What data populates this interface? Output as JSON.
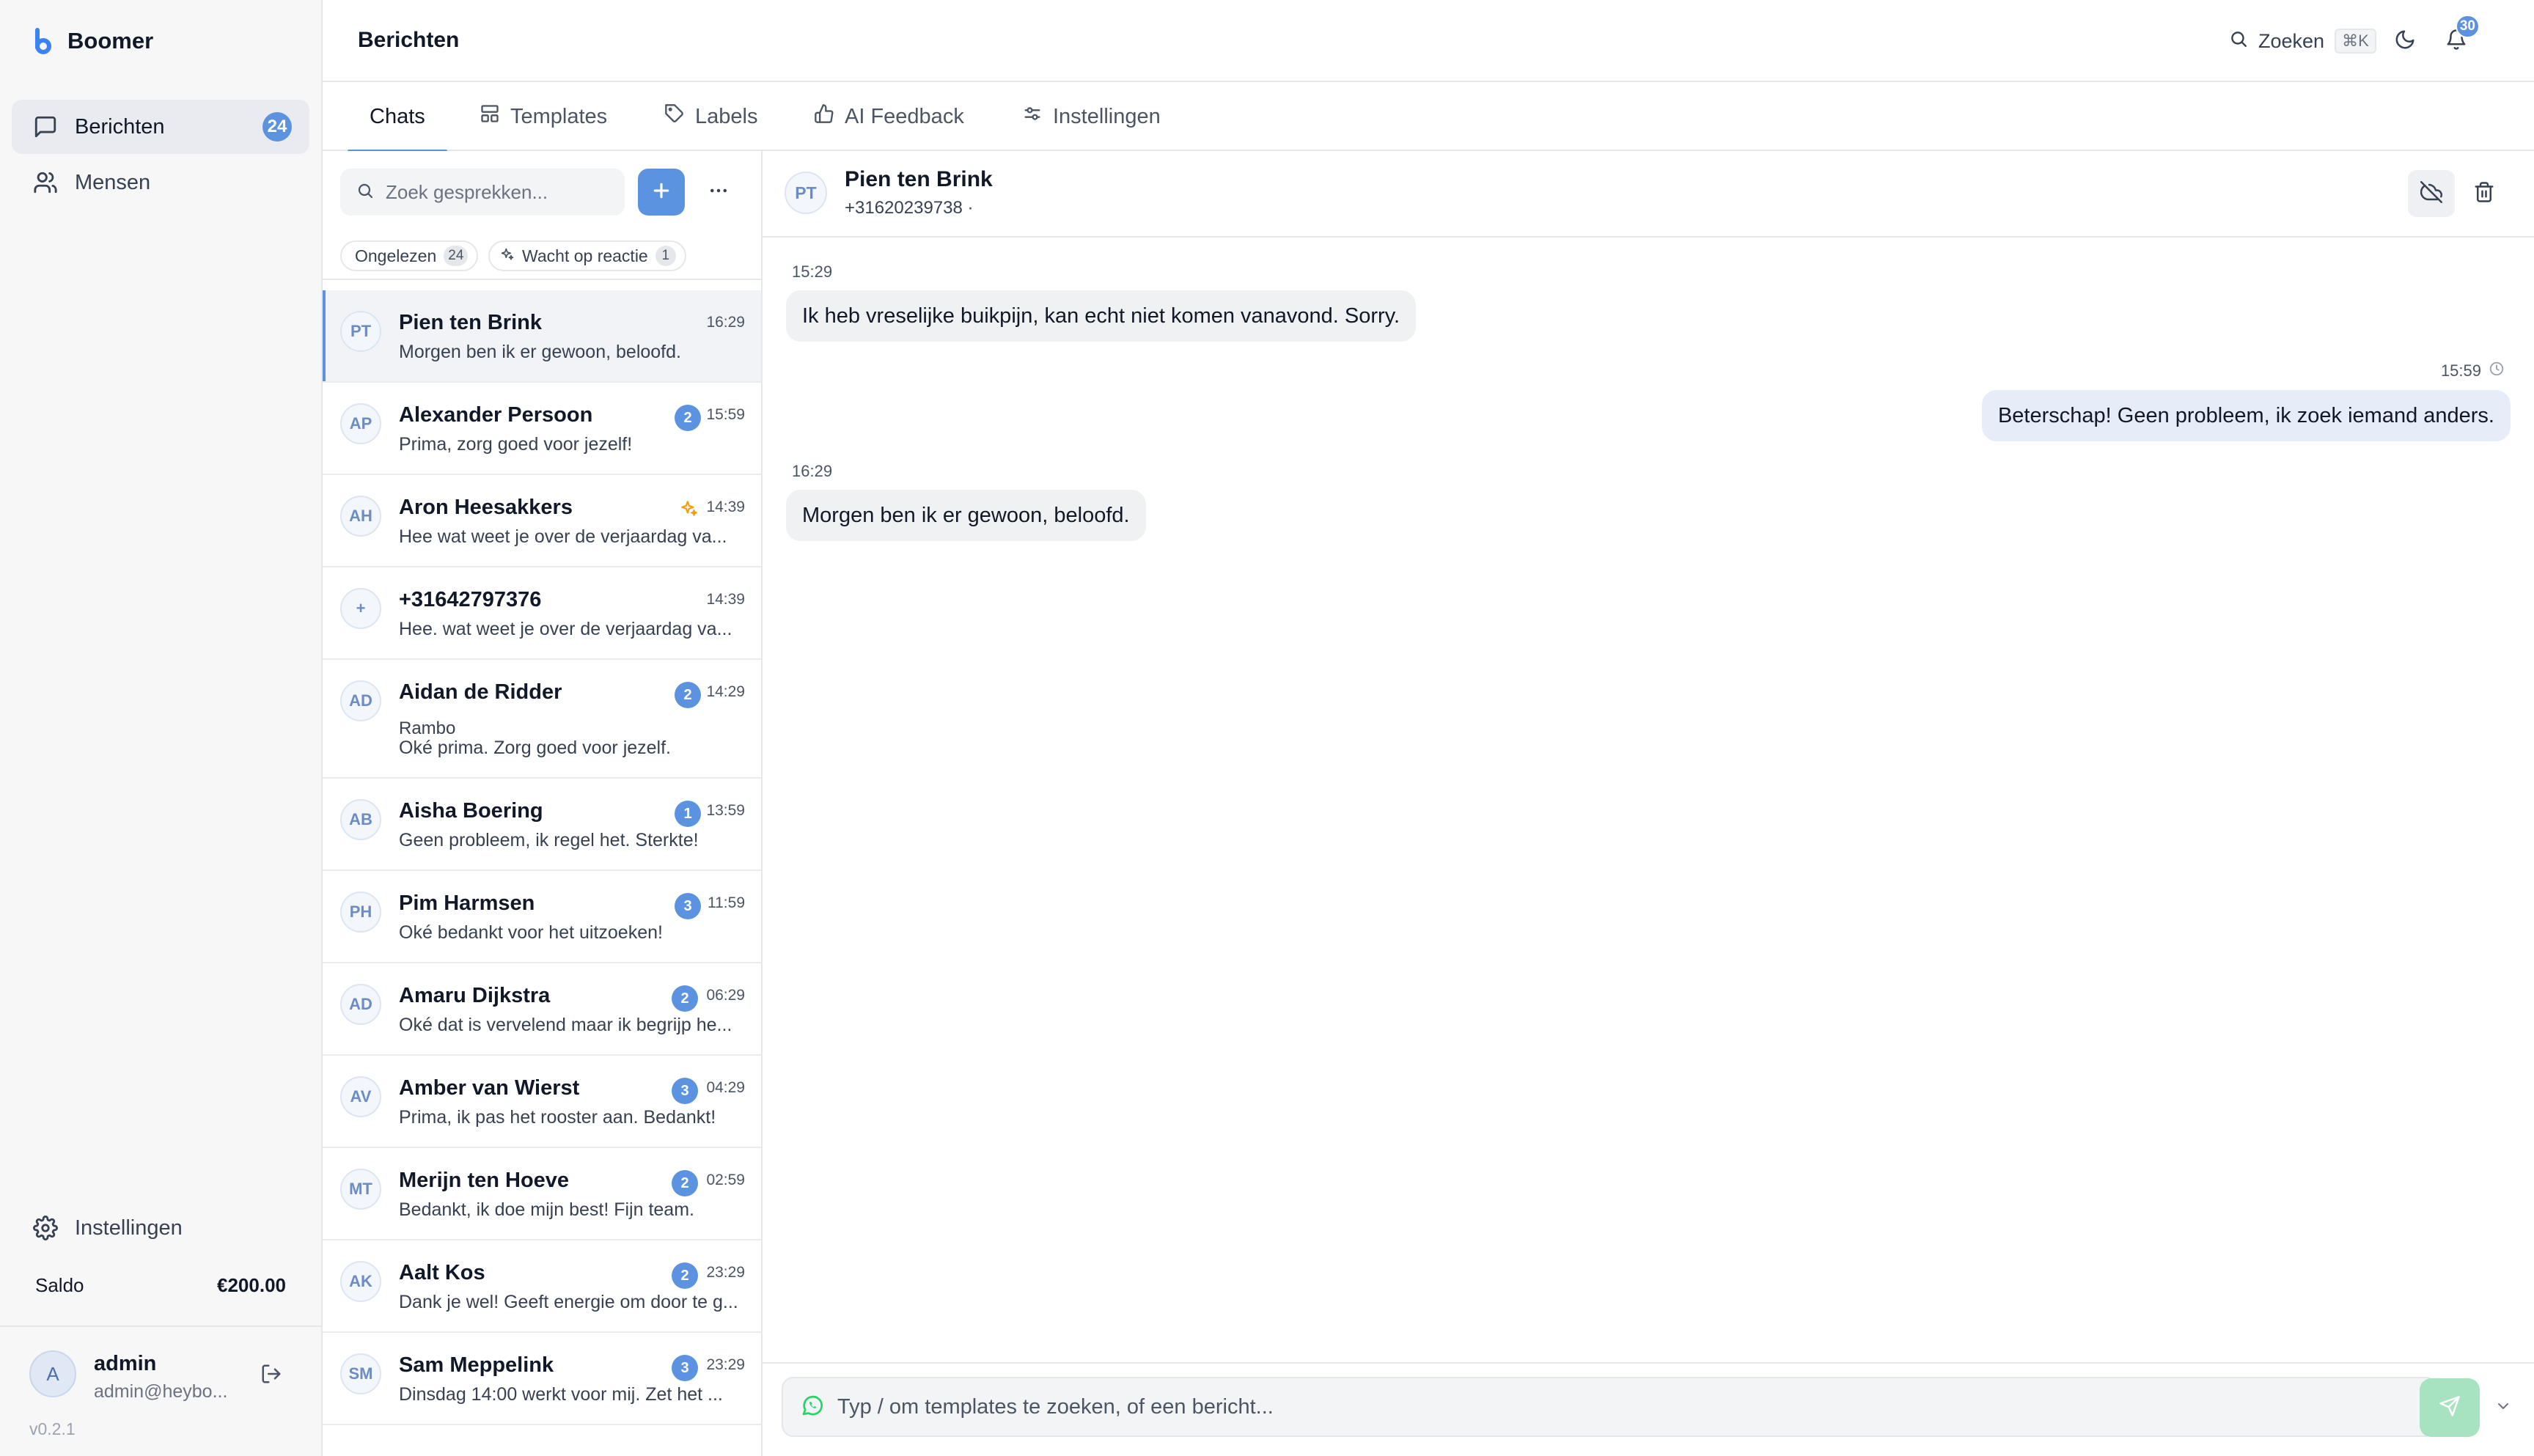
{
  "brand": {
    "name": "Boomer"
  },
  "sidebar": {
    "items": [
      {
        "label": "Berichten",
        "icon": "message-square-icon",
        "badge": "24",
        "active": true
      },
      {
        "label": "Mensen",
        "icon": "users-icon"
      }
    ],
    "settings_label": "Instellingen",
    "balance_label": "Saldo",
    "balance_value": "€200.00",
    "user": {
      "initial": "A",
      "name": "admin",
      "email": "admin@heybo..."
    },
    "version": "v0.2.1"
  },
  "header": {
    "title": "Berichten",
    "search_label": "Zoeken",
    "search_shortcut": "⌘K",
    "notifications_count": "30"
  },
  "tabs": [
    {
      "label": "Chats",
      "icon": "",
      "active": true
    },
    {
      "label": "Templates",
      "icon": "layout-icon"
    },
    {
      "label": "Labels",
      "icon": "tag-icon"
    },
    {
      "label": "AI Feedback",
      "icon": "thumbs-up-icon"
    },
    {
      "label": "Instellingen",
      "icon": "sliders-icon"
    }
  ],
  "chatlist": {
    "search_placeholder": "Zoek gesprekken...",
    "filters": [
      {
        "label": "Ongelezen",
        "count": "24"
      },
      {
        "label": "Wacht op reactie",
        "count": "1"
      }
    ],
    "rows": [
      {
        "initials": "PT",
        "name": "Pien ten Brink",
        "time": "16:29",
        "preview": "Morgen ben ik er gewoon, beloofd.",
        "selected": true
      },
      {
        "initials": "AP",
        "name": "Alexander Persoon",
        "time": "15:59",
        "badge": "2",
        "preview": "Prima, zorg goed voor jezelf!"
      },
      {
        "initials": "AH",
        "name": "Aron Heesakkers",
        "time": "14:39",
        "spark": true,
        "preview": "Hee wat weet je over de verjaardag va..."
      },
      {
        "initials": "+",
        "name": "+31642797376",
        "time": "14:39",
        "preview": "Hee. wat weet je over de verjaardag va..."
      },
      {
        "initials": "AD",
        "name": "Aidan de Ridder",
        "time": "14:29",
        "badge": "2",
        "sub": "Rambo",
        "preview": "Oké prima. Zorg goed voor jezelf."
      },
      {
        "initials": "AB",
        "name": "Aisha Boering",
        "time": "13:59",
        "badge": "1",
        "preview": "Geen probleem, ik regel het. Sterkte!"
      },
      {
        "initials": "PH",
        "name": "Pim Harmsen",
        "time": "11:59",
        "badge": "3",
        "preview": "Oké bedankt voor het uitzoeken!"
      },
      {
        "initials": "AD",
        "name": "Amaru Dijkstra",
        "time": "06:29",
        "badge": "2",
        "preview": "Oké dat is vervelend maar ik begrijp he..."
      },
      {
        "initials": "AV",
        "name": "Amber van Wierst",
        "time": "04:29",
        "badge": "3",
        "preview": "Prima, ik pas het rooster aan. Bedankt!"
      },
      {
        "initials": "MT",
        "name": "Merijn ten Hoeve",
        "time": "02:59",
        "badge": "2",
        "preview": "Bedankt, ik doe mijn best! Fijn team."
      },
      {
        "initials": "AK",
        "name": "Aalt Kos",
        "time": "23:29",
        "badge": "2",
        "preview": "Dank je wel! Geeft energie om door te g..."
      },
      {
        "initials": "SM",
        "name": "Sam Meppelink",
        "time": "23:29",
        "badge": "3",
        "preview": "Dinsdag 14:00 werkt voor mij. Zet het ..."
      }
    ]
  },
  "conversation": {
    "initials": "PT",
    "name": "Pien ten Brink",
    "phone": "+31620239738 ·",
    "messages": [
      {
        "direction": "in",
        "time": "15:29",
        "text": "Ik heb vreselijke buikpijn, kan echt niet komen vanavond. Sorry."
      },
      {
        "direction": "out",
        "time": "15:59",
        "text": "Beterschap! Geen probleem, ik zoek iemand anders."
      },
      {
        "direction": "in",
        "time": "16:29",
        "text": "Morgen ben ik er gewoon, beloofd."
      }
    ],
    "composer_placeholder": "Typ / om templates te zoeken, of een bericht..."
  },
  "colors": {
    "accent": "#5b93e0",
    "whatsapp": "#25d366",
    "send_disabled": "#a7e3c0",
    "spark": "#f59e0b"
  }
}
